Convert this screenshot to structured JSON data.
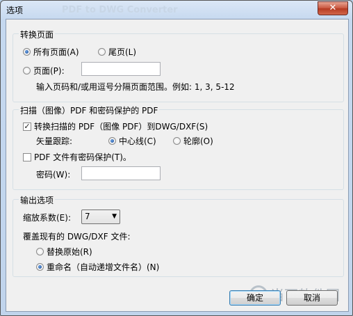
{
  "window": {
    "title": "选项",
    "close_symbol": "✕",
    "ghost_title": "PDF to DWG Converter"
  },
  "page_group": {
    "label": "转换页面",
    "all_pages": "所有页面(A)",
    "last_page": "尾页(L)",
    "pages": "页面(P):",
    "pages_value": "",
    "hint": "输入页码和/或用逗号分隔页面范围。例如: 1, 3, 5-12"
  },
  "scan_group": {
    "label": "扫描（图像）PDF 和密码保护的 PDF",
    "convert_scanned": "转换扫描的 PDF（图像 PDF）到DWG/DXF(S)",
    "vector_trace": "矢量跟踪:",
    "centerline": "中心线(C)",
    "outline": "轮廓(O)",
    "password_protected": "PDF 文件有密码保护(T)。",
    "password_label": "密码(W):",
    "password_value": ""
  },
  "output_group": {
    "label": "输出选项",
    "scale_label": "缩放系数(E):",
    "scale_value": "7",
    "overwrite_label": "覆盖现有的 DWG/DXF 文件:",
    "replace_original": "替换原始(R)",
    "rename": "重命名（自动递增文件名）(N)"
  },
  "buttons": {
    "ok": "确定",
    "cancel": "取消"
  },
  "watermark": {
    "text": "当下软件园"
  }
}
